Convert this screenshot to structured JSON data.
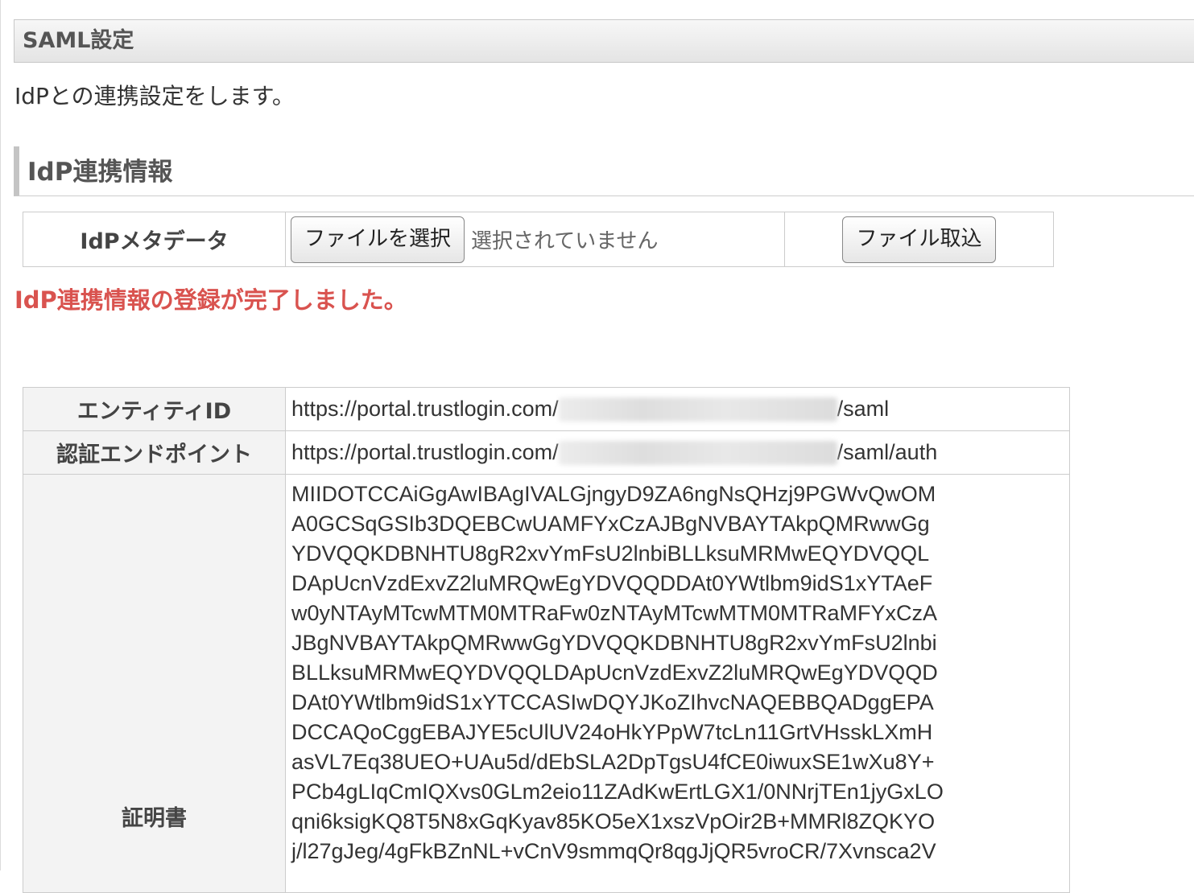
{
  "section": {
    "title": "SAML設定",
    "description": "IdPとの連携設定をします。"
  },
  "idp": {
    "title": "IdP連携情報",
    "metadata_label": "IdPメタデータ",
    "choose_file_label": "ファイルを選択",
    "no_file_text": "選択されていません",
    "import_label": "ファイル取込",
    "success_message": "IdP連携情報の登録が完了しました。"
  },
  "info": {
    "entity_id": {
      "label": "エンティティID",
      "prefix": "https://portal.trustlogin.com/",
      "suffix": "/saml"
    },
    "auth_endpoint": {
      "label": "認証エンドポイント",
      "prefix": "https://portal.trustlogin.com/",
      "suffix": "/saml/auth"
    },
    "certificate": {
      "label": "証明書",
      "lines": [
        "MIIDOTCCAiGgAwIBAgIVALGjngyD9ZA6ngNsQHzj9PGWvQwOM",
        "A0GCSqGSIb3DQEBCwUAMFYxCzAJBgNVBAYTAkpQMRwwGg",
        "YDVQQKDBNHTU8gR2xvYmFsU2lnbiBLLksuMRMwEQYDVQQL",
        "DApUcnVzdExvZ2luMRQwEgYDVQQDDAt0YWtlbm9idS1xYTAeF",
        "w0yNTAyMTcwMTM0MTRaFw0zNTAyMTcwMTM0MTRaMFYxCzA",
        "JBgNVBAYTAkpQMRwwGgYDVQQKDBNHTU8gR2xvYmFsU2lnbi",
        "BLLksuMRMwEQYDVQQLDApUcnVzdExvZ2luMRQwEgYDVQQD",
        "DAt0YWtlbm9idS1xYTCCASIwDQYJKoZIhvcNAQEBBQADggEPA",
        "DCCAQoCggEBAJYE5cUlUV24oHkYPpW7tcLn11GrtVHsskLXmH",
        "asVL7Eq38UEO+UAu5d/dEbSLA2DpTgsU4fCE0iwuxSE1wXu8Y+",
        "PCb4gLIqCmIQXvs0GLm2eio11ZAdKwErtLGX1/0NNrjTEn1jyGxLO",
        "qni6ksigKQ8T5N8xGqKyav85KO5eX1xszVpOir2B+MMRl8ZQKYO",
        "j/l27gJeg/4gFkBZnNL+vCnV9smmqQr8qgJjQR5vroCR/7Xvnsca2V"
      ]
    }
  }
}
